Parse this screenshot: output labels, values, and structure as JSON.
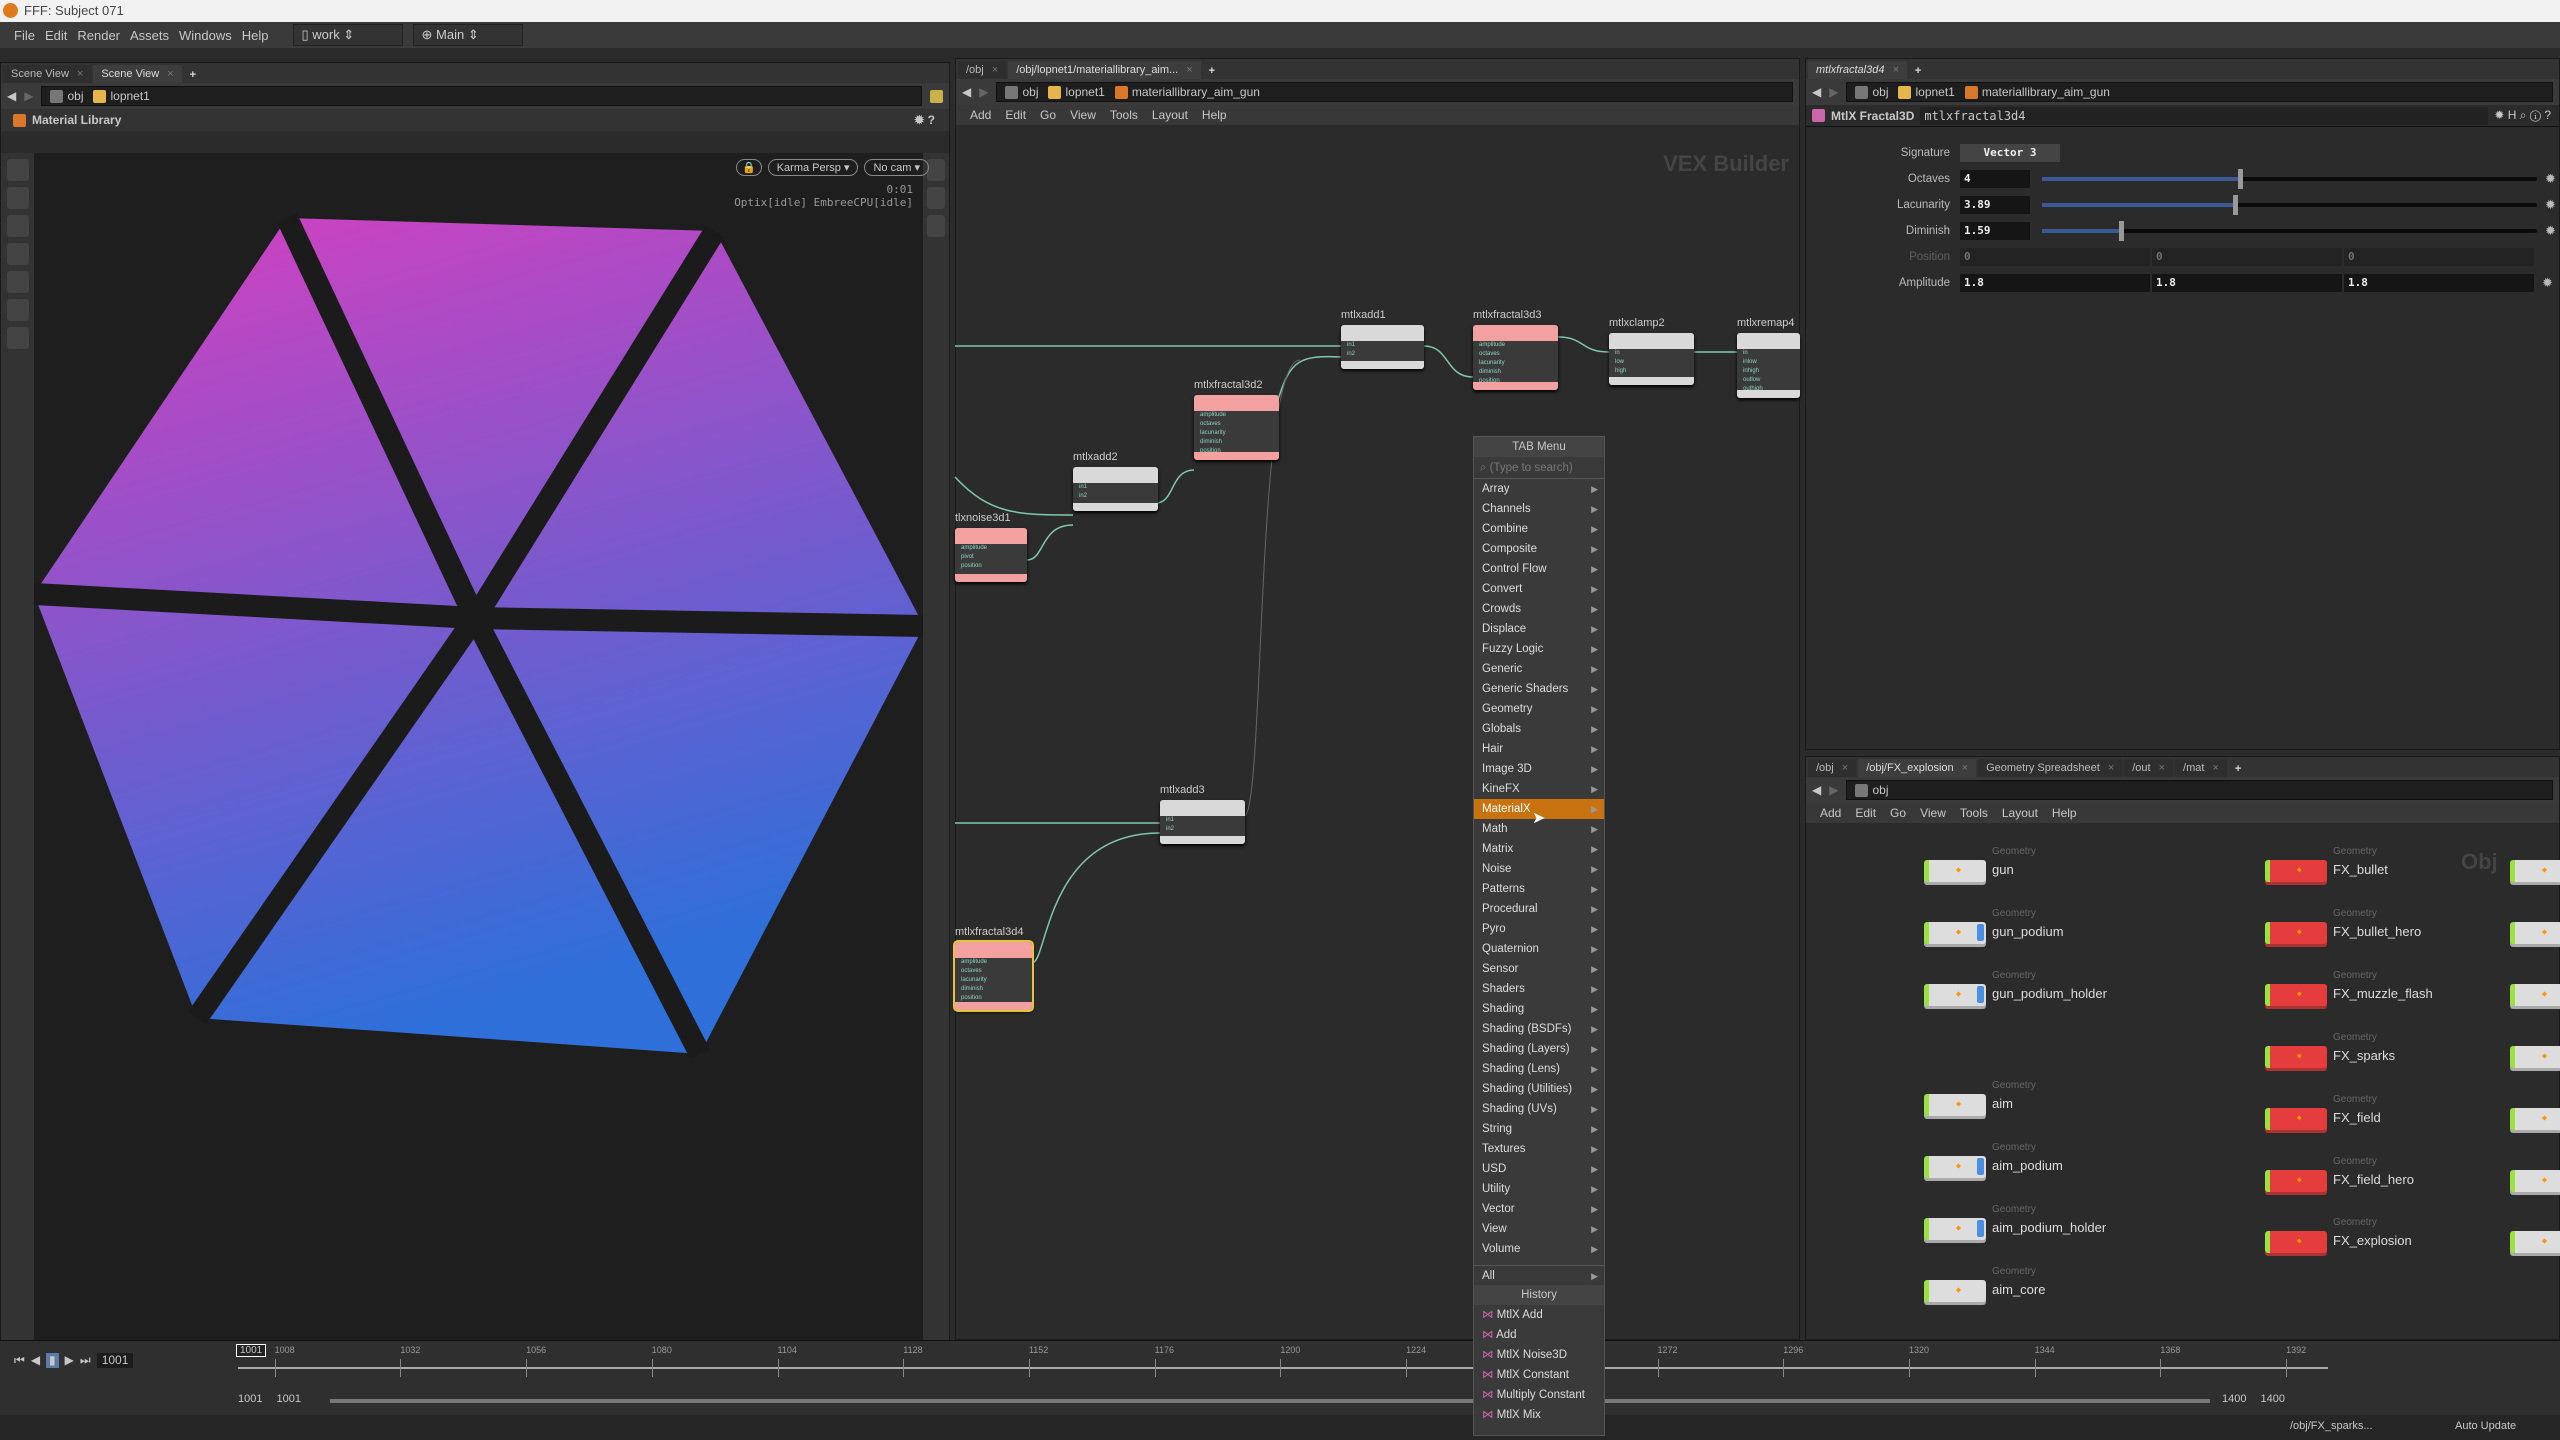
{
  "window_title": "FFF: Subject 071",
  "menubar": {
    "items": [
      "File",
      "Edit",
      "Render",
      "Assets",
      "Windows",
      "Help"
    ],
    "desktop": "work",
    "context": "Main"
  },
  "left_pane": {
    "tabs": [
      "Scene View",
      "Scene View"
    ],
    "path": [
      "obj",
      "lopnet1"
    ],
    "header": "Material Library",
    "camera_menu": "Karma Persp",
    "cam_menu": "No cam",
    "render_time": "0:01",
    "render_status": "Optix[idle] EmbreeCPU[idle]",
    "viewport_colors": {
      "top": "#d63fbf",
      "bottom": "#2f6fd9",
      "gap": "#1b1b1b"
    }
  },
  "network": {
    "tabs": [
      "/obj",
      "/obj/lopnet1/materiallibrary_aim..."
    ],
    "path": [
      "obj",
      "lopnet1",
      "materiallibrary_aim_gun"
    ],
    "menu": [
      "Add",
      "Edit",
      "Go",
      "View",
      "Tools",
      "Layout",
      "Help"
    ],
    "watermark": "VEX Builder",
    "nodes": {
      "mtlxadd1": {
        "name": "mtlxadd1",
        "ports": [
          "in1",
          "in2"
        ],
        "out": "out"
      },
      "mtlxfractal3d3": {
        "name": "mtlxfractal3d3",
        "ports": [
          "amplitude",
          "octaves",
          "lacunarity",
          "diminish",
          "position"
        ],
        "out": "out"
      },
      "mtlxclamp2": {
        "name": "mtlxclamp2",
        "ports": [
          "in",
          "low",
          "high"
        ],
        "out": "out"
      },
      "mtlxremap4": {
        "name": "mtlxremap4",
        "ports": [
          "in",
          "inlow",
          "inhigh",
          "outlow",
          "outhigh"
        ],
        "out": ""
      },
      "mtlxfractal3d2": {
        "name": "mtlxfractal3d2",
        "ports": [
          "amplitude",
          "octaves",
          "lacunarity",
          "diminish",
          "position"
        ],
        "out": "out"
      },
      "mtlxadd2": {
        "name": "mtlxadd2",
        "ports": [
          "in1",
          "in2"
        ],
        "out": "out"
      },
      "mtlxnoise3d1": {
        "name": "tlxnoise3d1",
        "ports": [
          "amplitude",
          "pivot",
          "position"
        ],
        "out": "out"
      },
      "mtlxadd3": {
        "name": "mtlxadd3",
        "ports": [
          "in1",
          "in2"
        ],
        "out": "out"
      },
      "mtlxfractal3d4": {
        "name": "mtlxfractal3d4",
        "ports": [
          "amplitude",
          "octaves",
          "lacunarity",
          "diminish",
          "position"
        ],
        "out": "out"
      }
    }
  },
  "tab_menu": {
    "title": "TAB Menu",
    "search_placeholder": "(Type to search)",
    "items": [
      "Array",
      "Channels",
      "Combine",
      "Composite",
      "Control Flow",
      "Convert",
      "Crowds",
      "Displace",
      "Fuzzy Logic",
      "Generic",
      "Generic Shaders",
      "Geometry",
      "Globals",
      "Hair",
      "Image 3D",
      "KineFX",
      "MaterialX",
      "Math",
      "Matrix",
      "Noise",
      "Patterns",
      "Procedural",
      "Pyro",
      "Quaternion",
      "Sensor",
      "Shaders",
      "Shading",
      "Shading (BSDFs)",
      "Shading (Layers)",
      "Shading (Lens)",
      "Shading (Utilities)",
      "Shading (UVs)",
      "String",
      "Textures",
      "USD",
      "Utility",
      "Vector",
      "View",
      "Volume"
    ],
    "highlighted": "MaterialX",
    "all": "All",
    "history_title": "History",
    "history": [
      "MtlX Add",
      "Add",
      "MtlX Noise3D",
      "MtlX Constant",
      "Multiply Constant",
      "MtlX Mix"
    ]
  },
  "params": {
    "tab": "mtlxfractal3d4",
    "path": [
      "obj",
      "lopnet1",
      "materiallibrary_aim_gun"
    ],
    "node_type": "MtlX Fractal3D",
    "node_name": "mtlxfractal3d4",
    "signature_label": "Signature",
    "signature": "Vector 3",
    "octaves_label": "Octaves",
    "octaves": "4",
    "octaves_fraction": 0.4,
    "lacunarity_label": "Lacunarity",
    "lacunarity": "3.89",
    "lacunarity_fraction": 0.39,
    "diminish_label": "Diminish",
    "diminish": "1.59",
    "diminish_fraction": 0.16,
    "position_label": "Position",
    "position": [
      "0",
      "0",
      "0"
    ],
    "amplitude_label": "Amplitude",
    "amplitude": [
      "1.8",
      "1.8",
      "1.8"
    ]
  },
  "obj_network": {
    "tabs": [
      "/obj",
      "/obj/FX_explosion",
      "Geometry Spreadsheet",
      "/out",
      "/mat"
    ],
    "path": [
      "obj"
    ],
    "menu": [
      "Add",
      "Edit",
      "Go",
      "View",
      "Tools",
      "Layout",
      "Help"
    ],
    "watermark": "Obj",
    "type_label": "Geometry",
    "left_nodes": [
      {
        "name": "gun",
        "blue": false
      },
      {
        "name": "gun_podium",
        "blue": true
      },
      {
        "name": "gun_podium_holder",
        "blue": true
      },
      {
        "name": "aim",
        "blue": false
      },
      {
        "name": "aim_podium",
        "blue": true
      },
      {
        "name": "aim_podium_holder",
        "blue": true
      },
      {
        "name": "aim_core",
        "blue": false
      }
    ],
    "right_nodes": [
      "FX_bullet",
      "FX_bullet_hero",
      "FX_muzzle_flash",
      "FX_sparks",
      "FX_field",
      "FX_field_hero",
      "FX_explosion"
    ]
  },
  "timeline": {
    "current_frame": "1001",
    "frame_field": "1001",
    "ticks": [
      "1008",
      "1032",
      "1056",
      "1080",
      "1104",
      "1128",
      "1152",
      "1176",
      "1200",
      "1224",
      "1248",
      "1272",
      "1296",
      "1320",
      "1344",
      "1368",
      "1392"
    ],
    "range_start": "1001",
    "range_start2": "1001",
    "range_end": "1400",
    "range_end2": "1400"
  },
  "status": {
    "path": "/obj/FX_sparks...",
    "update": "Auto Update"
  }
}
